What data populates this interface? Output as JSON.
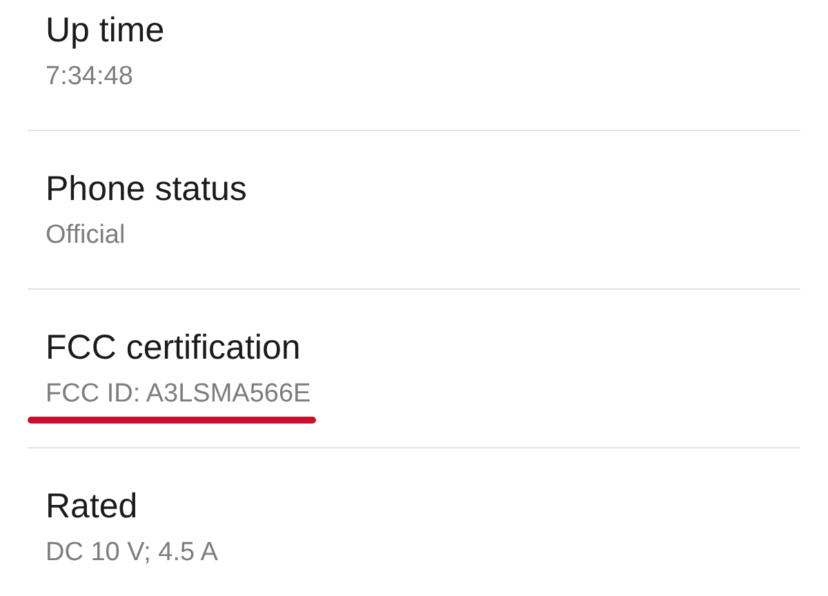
{
  "items": [
    {
      "title": "Up time",
      "value": "7:34:48",
      "underlined": false
    },
    {
      "title": "Phone status",
      "value": "Official",
      "underlined": false
    },
    {
      "title": "FCC certification",
      "value": "FCC ID: A3LSMA566E",
      "underlined": true
    },
    {
      "title": "Rated",
      "value": "DC 10 V; 4.5 A",
      "underlined": false
    }
  ]
}
